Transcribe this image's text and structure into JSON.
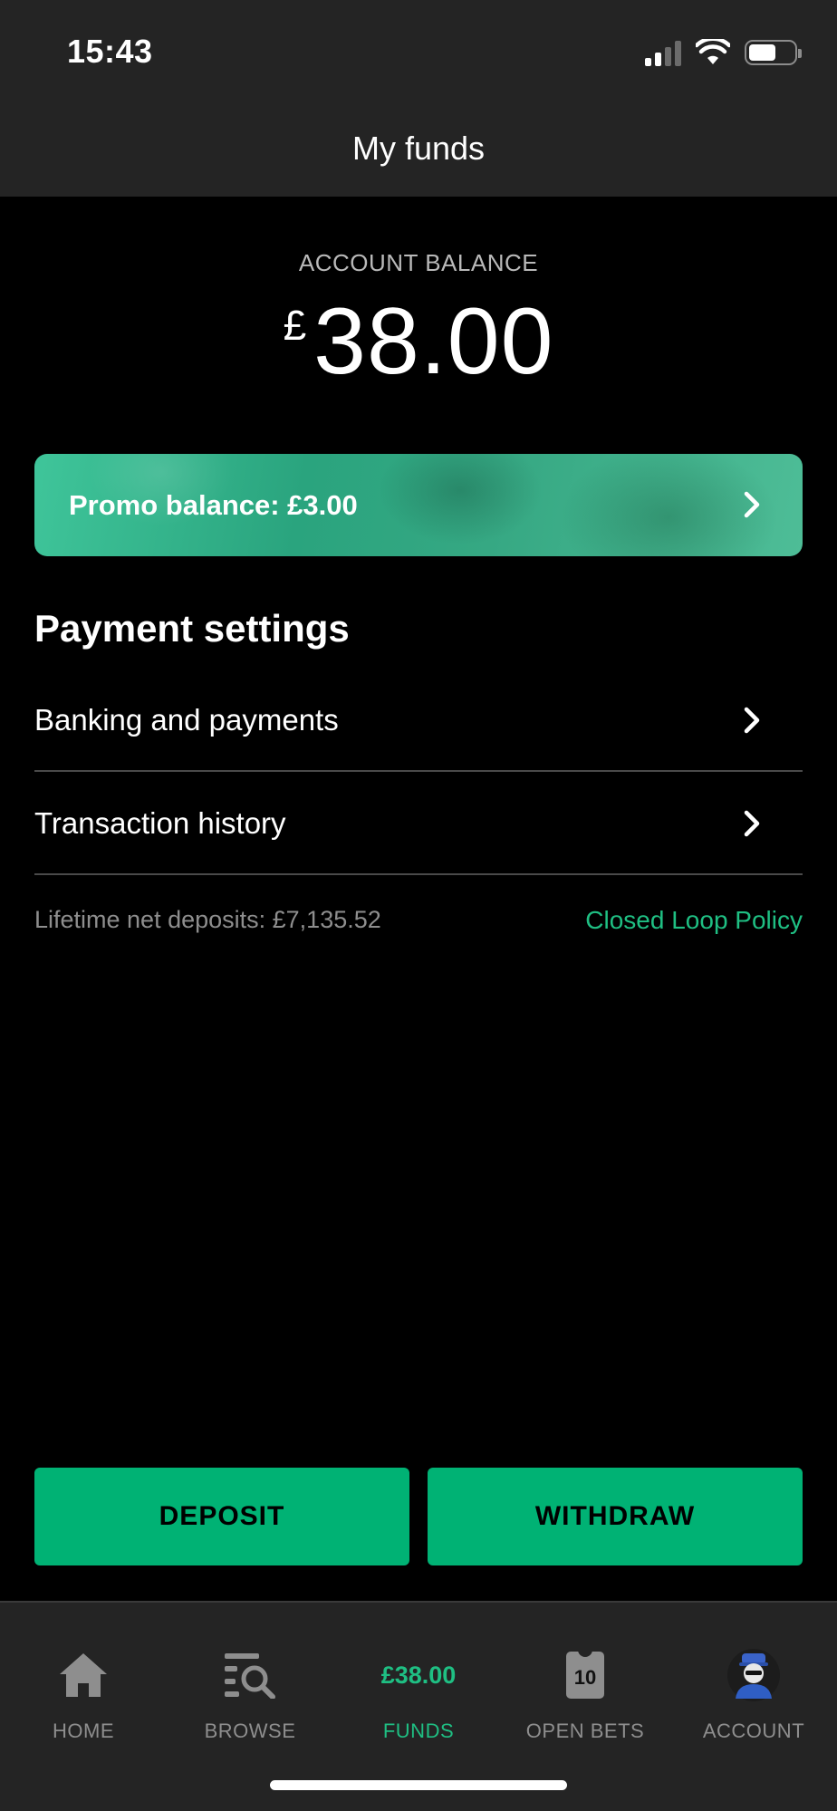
{
  "status_bar": {
    "time": "15:43",
    "battery_level": 0.6
  },
  "header": {
    "title": "My funds"
  },
  "balance": {
    "label": "ACCOUNT BALANCE",
    "currency": "£",
    "amount": "38.00"
  },
  "promo": {
    "text": "Promo balance: £3.00"
  },
  "payment_settings": {
    "title": "Payment settings",
    "items": [
      {
        "label": "Banking and payments"
      },
      {
        "label": "Transaction history"
      }
    ]
  },
  "footer_info": {
    "lifetime_deposits": "Lifetime net deposits: £7,135.52",
    "policy_link": "Closed Loop Policy"
  },
  "actions": {
    "deposit": "DEPOSIT",
    "withdraw": "WITHDRAW"
  },
  "tabbar": {
    "items": [
      {
        "label": "HOME",
        "icon": "home-icon"
      },
      {
        "label": "BROWSE",
        "icon": "browse-icon"
      },
      {
        "label": "FUNDS",
        "value": "£38.00",
        "active": true
      },
      {
        "label": "OPEN BETS",
        "icon": "open-bets-icon",
        "badge": "10"
      },
      {
        "label": "ACCOUNT",
        "icon": "avatar"
      }
    ]
  },
  "colors": {
    "accent": "#00b274",
    "accent_text": "#1fbf83",
    "bar_bg": "#242424"
  }
}
